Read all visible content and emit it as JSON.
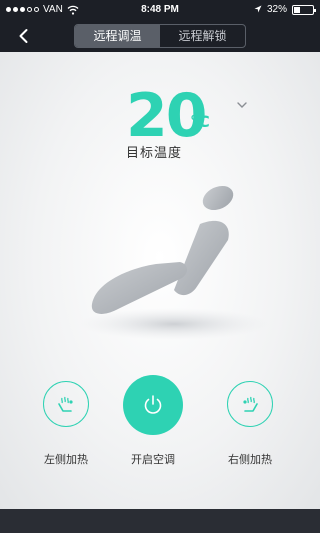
{
  "status_bar": {
    "carrier": "VAN",
    "time": "8:48 PM",
    "battery": "32%",
    "battery_level": 0.32
  },
  "nav": {
    "back_icon": "chevron-left-icon",
    "tabs": [
      {
        "label": "远程调温",
        "active": true
      },
      {
        "label": "远程解锁",
        "active": false
      }
    ]
  },
  "temperature": {
    "value": "20",
    "unit": "°C",
    "label": "目标温度",
    "dropdown_icon": "chevron-down-icon"
  },
  "controls": {
    "left": {
      "label": "左侧加热",
      "icon": "seat-heat-icon"
    },
    "main": {
      "label": "开启空调",
      "icon": "power-icon"
    },
    "right": {
      "label": "右侧加热",
      "icon": "seat-heat-icon"
    }
  },
  "colors": {
    "accent": "#2ed2b3",
    "header_bg": "#1c1f26"
  }
}
